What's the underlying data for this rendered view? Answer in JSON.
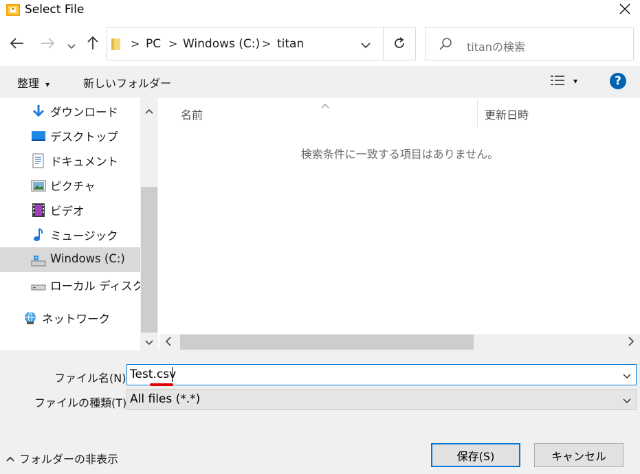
{
  "window": {
    "title": "Select File",
    "close_icon": "close-icon"
  },
  "nav": {
    "back_icon": "back-arrow-icon",
    "forward_icon": "forward-arrow-icon",
    "recent_icon": "chevron-down-icon",
    "up_icon": "up-arrow-icon",
    "breadcrumbs": [
      "PC",
      "Windows (C:)",
      "titan"
    ],
    "separator": ">",
    "refresh_icon": "refresh-icon",
    "search_placeholder": "titanの検索"
  },
  "commandbar": {
    "organize_label": "整理",
    "organize_caret": "▾",
    "new_folder_label": "新しいフォルダー",
    "view_caret": "▾",
    "help_label": "?"
  },
  "sidebar": {
    "items": [
      {
        "label": "ダウンロード",
        "icon": "download-icon"
      },
      {
        "label": "デスクトップ",
        "icon": "desktop-icon"
      },
      {
        "label": "ドキュメント",
        "icon": "document-icon"
      },
      {
        "label": "ピクチャ",
        "icon": "pictures-icon"
      },
      {
        "label": "ビデオ",
        "icon": "video-icon"
      },
      {
        "label": "ミュージック",
        "icon": "music-icon"
      },
      {
        "label": "Windows (C:)",
        "icon": "windows-drive-icon"
      },
      {
        "label": "ローカル ディスク (D",
        "icon": "drive-icon"
      },
      {
        "label": "ネットワーク",
        "icon": "network-icon"
      }
    ]
  },
  "filelist": {
    "columns": [
      "名前",
      "更新日時"
    ],
    "empty_message": "検索条件に一致する項目はありません。"
  },
  "form": {
    "filename_label": "ファイル名(N):",
    "filename_value": "Test.csv",
    "filetype_label": "ファイルの種類(T):",
    "filetype_value": "All files (*.*)"
  },
  "footer": {
    "hide_folders_label": "フォルダーの非表示",
    "save_label": "保存(S)",
    "cancel_label": "キャンセル"
  },
  "colors": {
    "accent": "#0078d7",
    "help": "#0063b1",
    "underline_mark": "#e00000"
  }
}
